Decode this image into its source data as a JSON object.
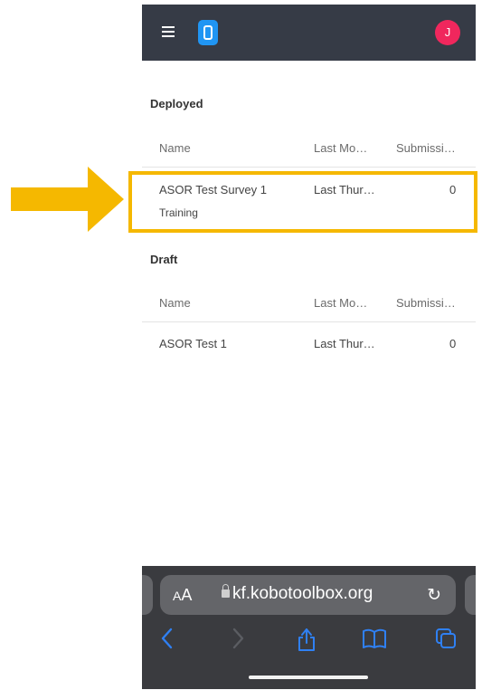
{
  "header": {
    "avatar_initial": "J"
  },
  "deployed": {
    "title": "Deployed",
    "columns": {
      "name": "Name",
      "modified": "Last Mo…",
      "submissions": "Submissi…"
    },
    "rows": [
      {
        "name": "ASOR Test Survey 1",
        "subtitle": "Training",
        "modified": "Last Thur…",
        "submissions": "0"
      }
    ]
  },
  "draft": {
    "title": "Draft",
    "columns": {
      "name": "Name",
      "modified": "Last Mo…",
      "submissions": "Submissi…"
    },
    "rows": [
      {
        "name": "ASOR Test 1",
        "modified": "Last Thur…",
        "submissions": "0"
      }
    ]
  },
  "safari": {
    "text_size": {
      "small": "A",
      "large": "A"
    },
    "url": "kf.kobotoolbox.org"
  },
  "colors": {
    "topbar": "#363b46",
    "logo": "#2095f3",
    "avatar": "#f0275d",
    "highlight": "#f5b800",
    "safari_accent": "#2f80f3"
  }
}
